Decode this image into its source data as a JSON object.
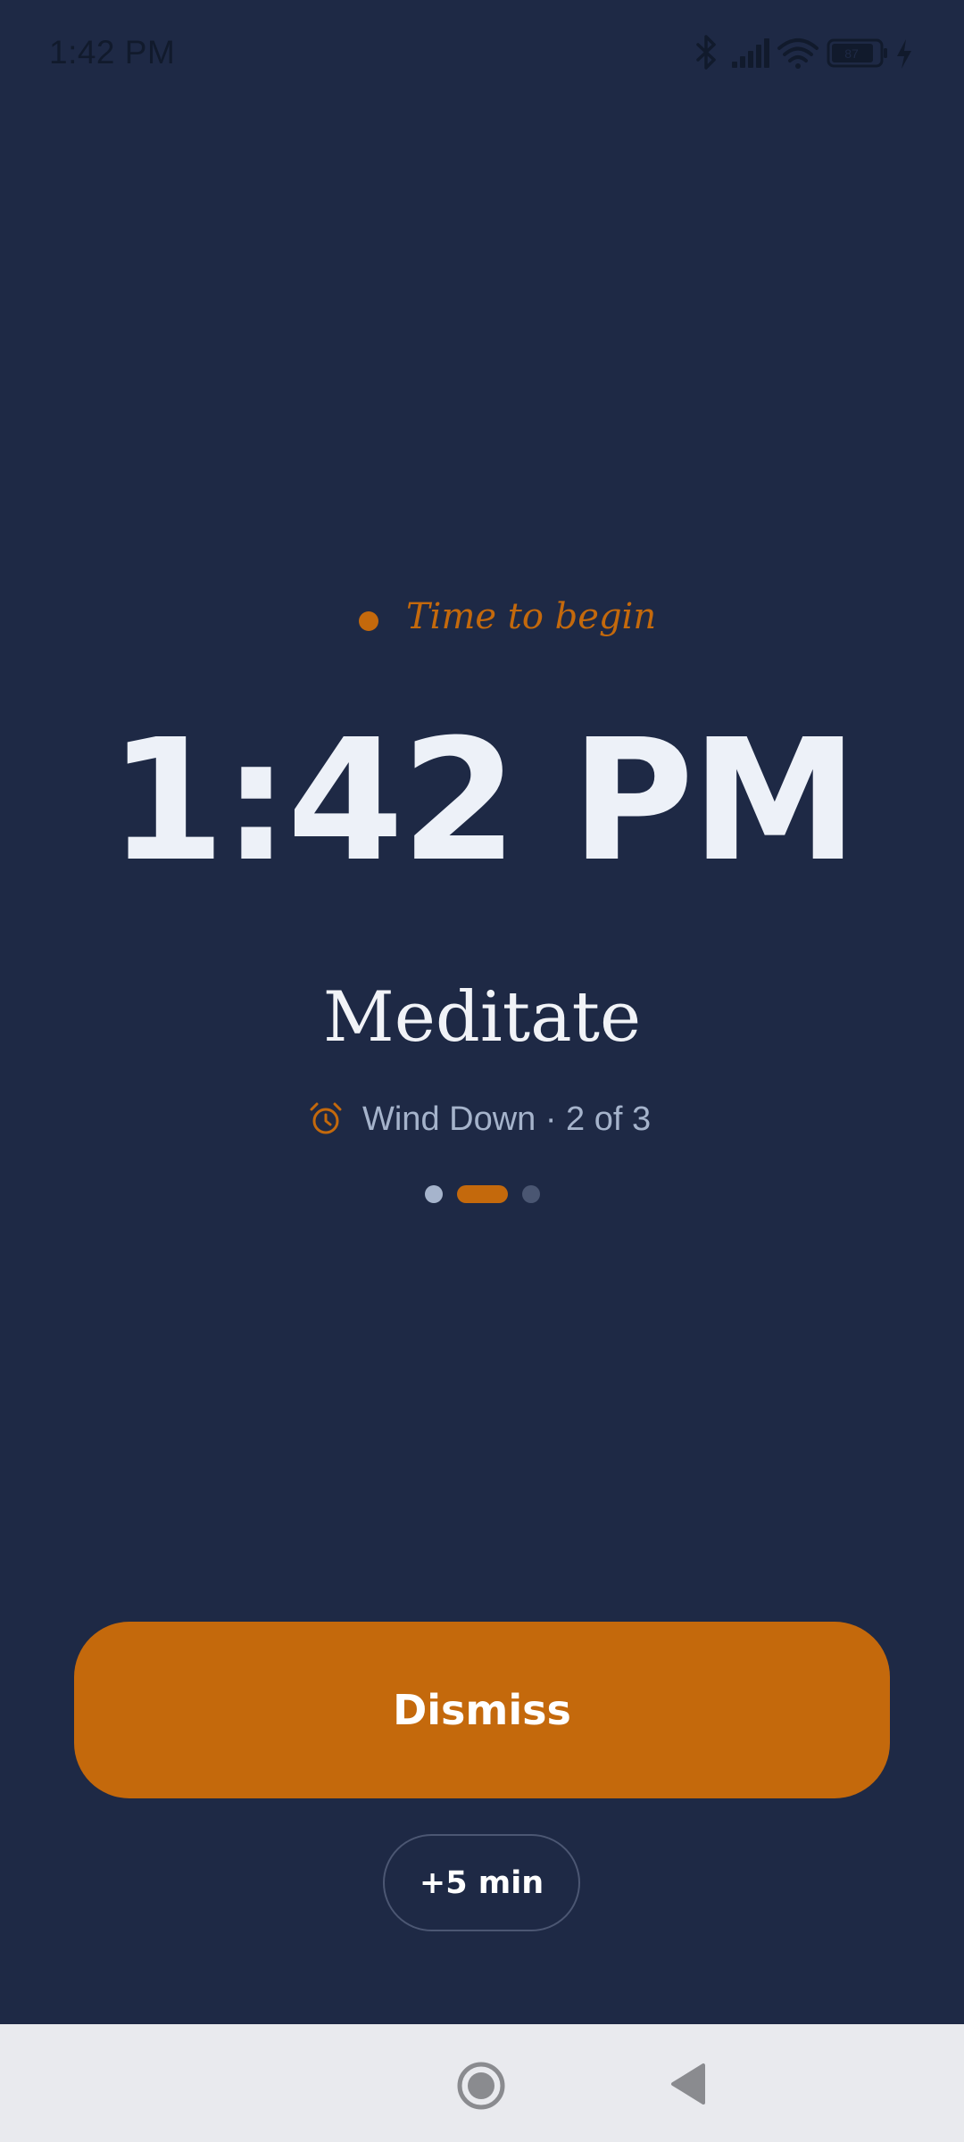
{
  "status_bar": {
    "time": "1:42 PM",
    "battery_level": "87",
    "icons": [
      "bluetooth-icon",
      "signal-icon",
      "wifi-icon",
      "battery-icon",
      "charging-icon"
    ]
  },
  "alarm": {
    "tagline": "Time to begin",
    "time": "1:42 PM",
    "task": "Meditate",
    "routine": "Wind Down · 2 of 3",
    "routine_icon": "alarm-clock-icon",
    "step_current": 2,
    "step_total": 3
  },
  "actions": {
    "dismiss_label": "Dismiss",
    "snooze_label": "+5 min"
  },
  "navigation": {
    "icons": [
      "home-icon",
      "back-icon"
    ]
  },
  "colors": {
    "background": "#1e2945",
    "accent": "#c4690c",
    "muted_text": "#a5b3cb",
    "nav_bar": "#e9eaee"
  }
}
